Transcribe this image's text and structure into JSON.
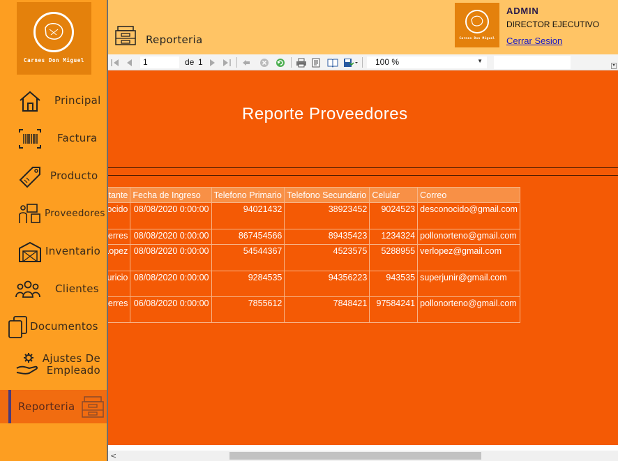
{
  "brand": {
    "name": "Carnes Don Miguel"
  },
  "sidebar": {
    "items": [
      {
        "label": "Principal",
        "icon": "home-icon"
      },
      {
        "label": "Factura",
        "icon": "barcode-icon"
      },
      {
        "label": "Producto",
        "icon": "price-tag-icon"
      },
      {
        "label": "Proveedores",
        "icon": "supplier-boxes-icon"
      },
      {
        "label": "Inventario",
        "icon": "warehouse-icon"
      },
      {
        "label": "Clientes",
        "icon": "users-icon"
      },
      {
        "label": "Documentos",
        "icon": "documents-icon"
      },
      {
        "label": "Ajustes De Empleado",
        "icon": "employee-settings-icon"
      },
      {
        "label": "Reporteria",
        "icon": "file-cabinet-icon",
        "active": true
      }
    ]
  },
  "header": {
    "title": "Reporteria",
    "user": {
      "name": "ADMIN",
      "role": "DIRECTOR EJECUTIVO",
      "logout_label": "Cerrar Sesion"
    }
  },
  "toolbar": {
    "current_page": "1",
    "of_label": "de",
    "total_pages": "1",
    "zoom": "100 %"
  },
  "report": {
    "title": "Reporte Proveedores",
    "columns": [
      "Representante",
      "Fecha de Ingreso",
      "Telefono Primario",
      "Telefono Secundario",
      "Celular",
      "Correo"
    ],
    "rows": [
      [
        "Desconocido desconocido",
        "08/08/2020 0:00:00",
        "94021432",
        "38923452",
        "9024523",
        "desconocido@gmail.com"
      ],
      [
        "Pollo Gutierres",
        "08/08/2020 0:00:00",
        "867454566",
        "89435423",
        "1234324",
        "pollonorteno@gmail.com"
      ],
      [
        "Veronica Lopez",
        "08/08/2020 0:00:00",
        "54544367",
        "4523575",
        "5288955",
        "verlopez@gmail.com"
      ],
      [
        "Junior y Mauricio",
        "08/08/2020 0:00:00",
        "9284535",
        "94356223",
        "943535",
        "superjunir@gmail.com"
      ],
      [
        "Pollo Gutierres",
        "06/08/2020 0:00:00",
        "7855612",
        "7848421",
        "97584241",
        "pollonorteno@gmail.com"
      ]
    ]
  },
  "colors": {
    "sidebar": "#fd9e21",
    "header": "#ffc465",
    "report_bg": "#f45a05",
    "active_item": "#f16c10"
  }
}
